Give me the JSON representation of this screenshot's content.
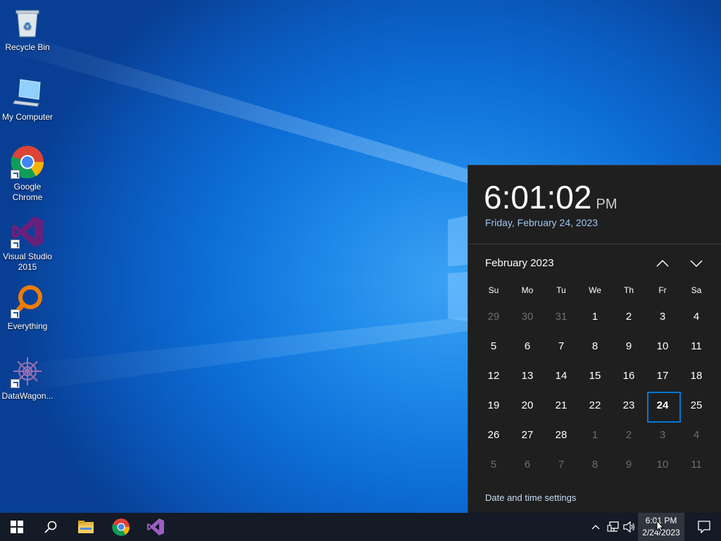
{
  "desktop": {
    "icons": [
      {
        "label": "Recycle Bin"
      },
      {
        "label": "My Computer"
      },
      {
        "label": "Google Chrome"
      },
      {
        "label": "Visual Studio 2015"
      },
      {
        "label": "Everything"
      },
      {
        "label": "DataWagon..."
      }
    ]
  },
  "flyout": {
    "time": "6:01:02",
    "ampm": "PM",
    "long_date": "Friday, February 24, 2023",
    "month_label": "February 2023",
    "weekdays": [
      "Su",
      "Mo",
      "Tu",
      "We",
      "Th",
      "Fr",
      "Sa"
    ],
    "days": [
      {
        "n": "29",
        "muted": true
      },
      {
        "n": "30",
        "muted": true
      },
      {
        "n": "31",
        "muted": true
      },
      {
        "n": "1"
      },
      {
        "n": "2"
      },
      {
        "n": "3"
      },
      {
        "n": "4"
      },
      {
        "n": "5"
      },
      {
        "n": "6"
      },
      {
        "n": "7"
      },
      {
        "n": "8"
      },
      {
        "n": "9"
      },
      {
        "n": "10"
      },
      {
        "n": "11"
      },
      {
        "n": "12"
      },
      {
        "n": "13"
      },
      {
        "n": "14"
      },
      {
        "n": "15"
      },
      {
        "n": "16"
      },
      {
        "n": "17"
      },
      {
        "n": "18"
      },
      {
        "n": "19"
      },
      {
        "n": "20"
      },
      {
        "n": "21"
      },
      {
        "n": "22"
      },
      {
        "n": "23"
      },
      {
        "n": "24",
        "today": true
      },
      {
        "n": "25"
      },
      {
        "n": "26"
      },
      {
        "n": "27"
      },
      {
        "n": "28"
      },
      {
        "n": "1",
        "muted": true
      },
      {
        "n": "2",
        "muted": true
      },
      {
        "n": "3",
        "muted": true
      },
      {
        "n": "4",
        "muted": true
      },
      {
        "n": "5",
        "muted": true
      },
      {
        "n": "6",
        "muted": true
      },
      {
        "n": "7",
        "muted": true
      },
      {
        "n": "8",
        "muted": true
      },
      {
        "n": "9",
        "muted": true
      },
      {
        "n": "10",
        "muted": true
      },
      {
        "n": "11",
        "muted": true
      }
    ],
    "settings_link": "Date and time settings"
  },
  "taskbar": {
    "pinned": [
      "start-icon",
      "search-icon",
      "file-explorer-icon",
      "chrome-icon",
      "visual-studio-icon"
    ],
    "clock_time": "6:01 PM",
    "clock_date": "2/24/2023"
  },
  "colors": {
    "accent": "#0078d7",
    "flyout_bg": "#1f1f1f",
    "taskbar_bg": "#141a26"
  }
}
